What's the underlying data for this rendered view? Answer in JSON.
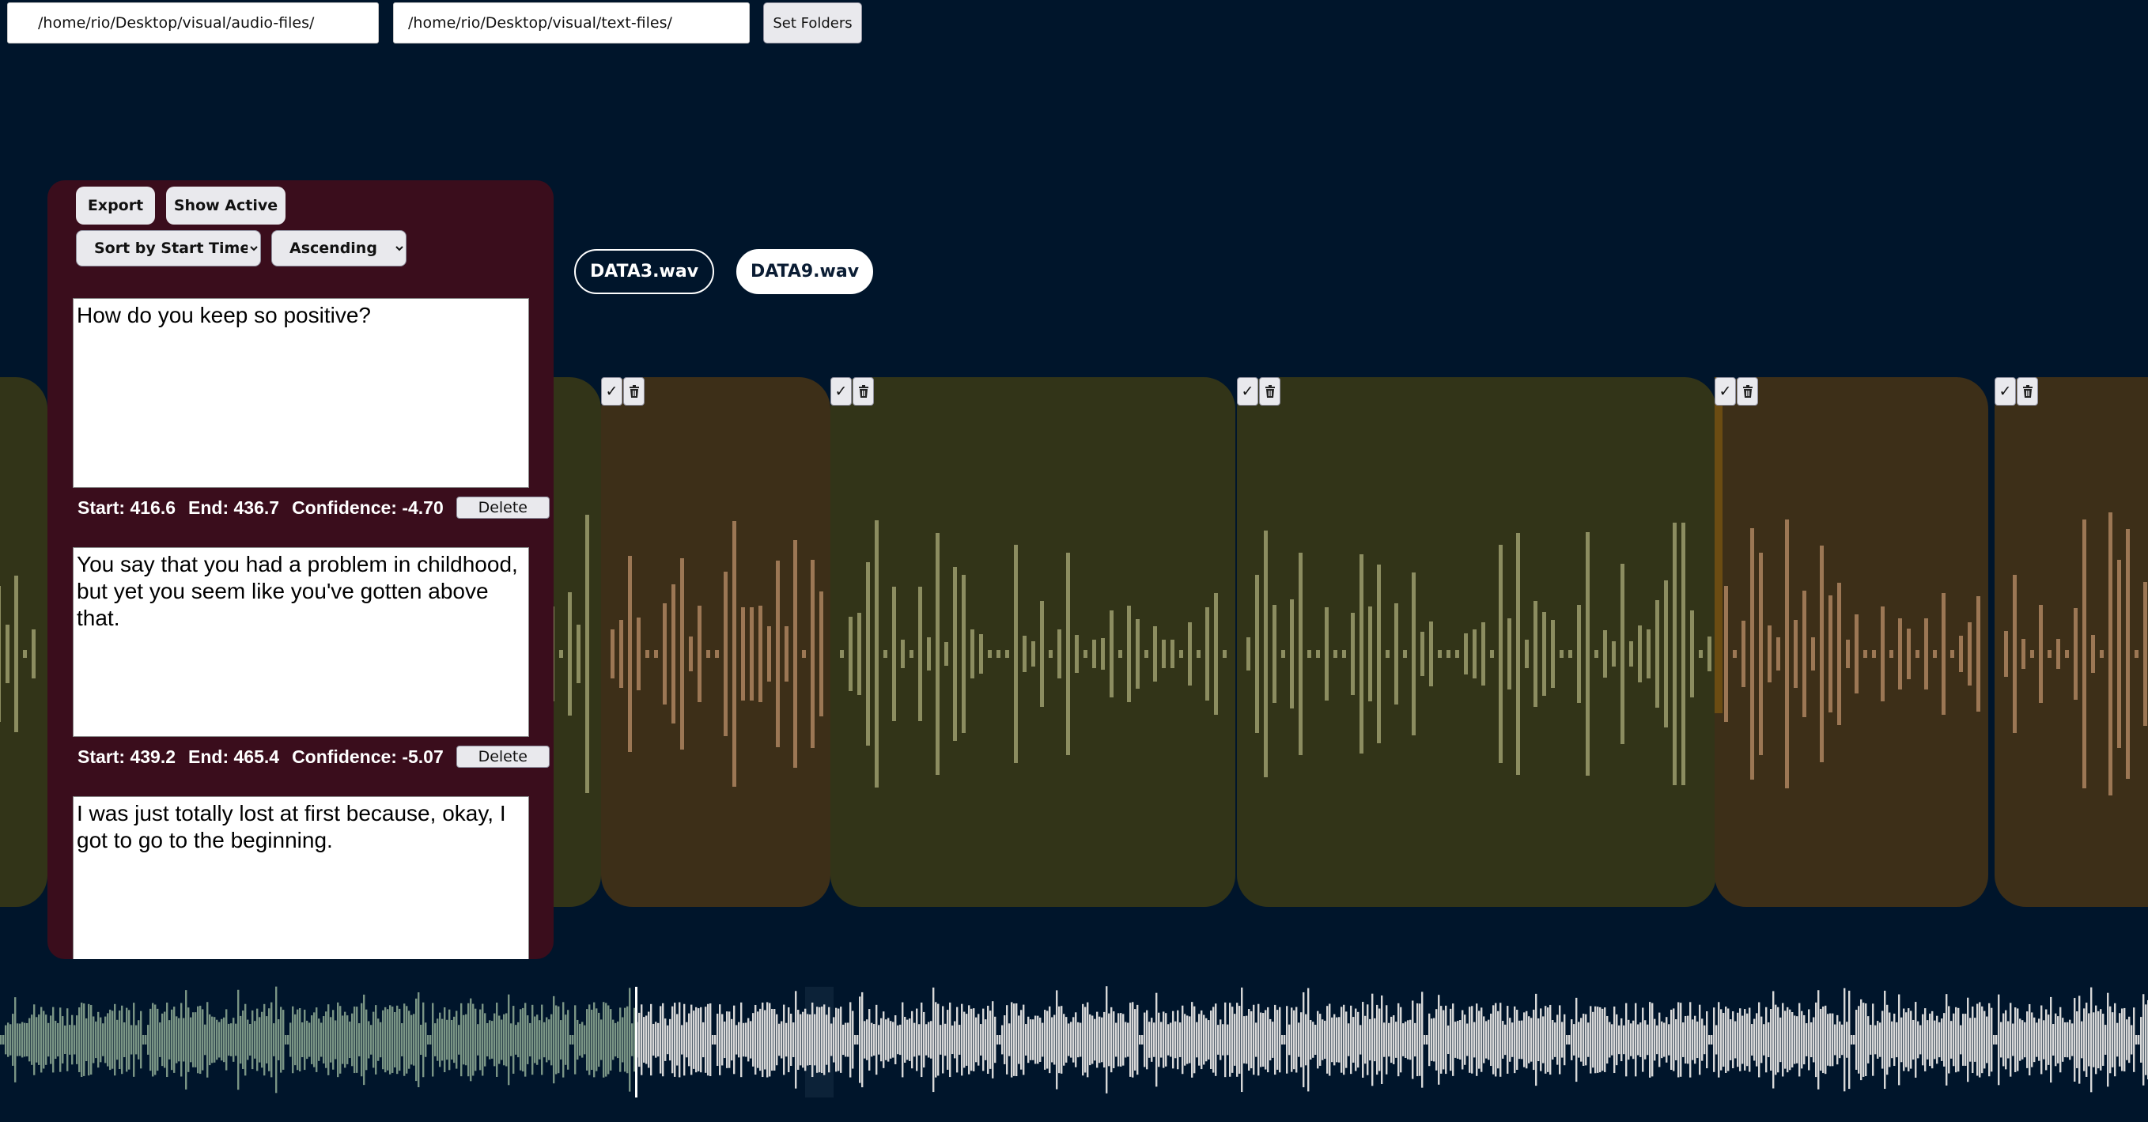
{
  "folders": {
    "audio_path": "/home/rio/Desktop/visual/audio-files/",
    "text_path": "/home/rio/Desktop/visual/text-files/",
    "set_label": "Set Folders"
  },
  "files": [
    {
      "label": "DATA3.wav",
      "active": false
    },
    {
      "label": "DATA9.wav",
      "active": true
    }
  ],
  "panel": {
    "export_label": "Export",
    "show_active_label": "Show Active",
    "sort_selected": "Sort by Start Time",
    "order_selected": "Ascending",
    "segments": [
      {
        "text": "How do you keep so positive?",
        "start_label": "Start: 416.6",
        "end_label": "End: 436.7",
        "confidence_label": "Confidence: -4.70",
        "delete_label": "Delete"
      },
      {
        "text": "You say that you had a problem in childhood, but yet you seem like you've gotten above that.",
        "start_label": "Start: 439.2",
        "end_label": "End: 465.4",
        "confidence_label": "Confidence: -5.07",
        "delete_label": "Delete"
      },
      {
        "text": "I was just totally lost at first because, okay, I got to go to the beginning."
      }
    ]
  },
  "segment_controls": {
    "check_icon": "✓",
    "trash_icon": "trash-icon"
  },
  "colors": {
    "background": "#00152b",
    "panel": "#3a0d1c",
    "segment_green": "#323418",
    "segment_brown": "#3d2f18",
    "overview_played": "#7a9585",
    "overview_rest": "#d8d8d8"
  }
}
